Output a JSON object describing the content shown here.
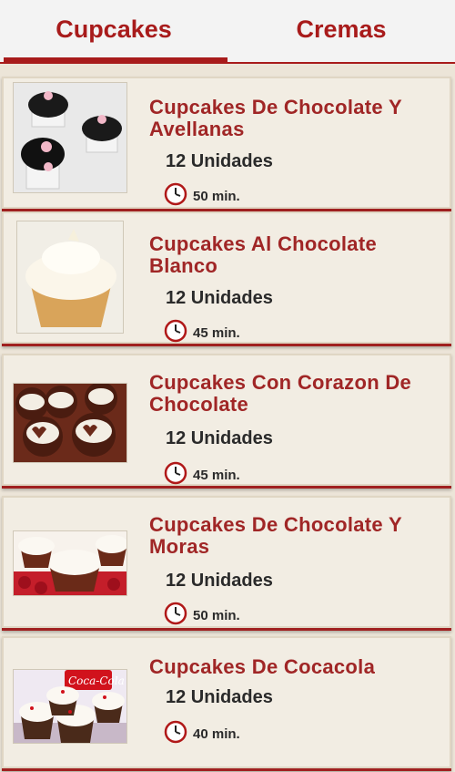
{
  "tabs": [
    {
      "label": "Cupcakes",
      "selected": true
    },
    {
      "label": "Cremas",
      "selected": false
    }
  ],
  "accent_color": "#a81b1b",
  "recipes": [
    {
      "title": "Cupcakes De Chocolate Y Avellanas",
      "units": "12 Unidades",
      "time": "50 min.",
      "image": "chocolate-cupcakes-flowers-photo"
    },
    {
      "title": "Cupcakes Al Chocolate Blanco",
      "units": "12 Unidades",
      "time": "45 min.",
      "image": "white-chocolate-cupcake-photo"
    },
    {
      "title": "Cupcakes Con Corazon De Chocolate",
      "units": "12 Unidades",
      "time": "45 min.",
      "image": "heart-cupcakes-photo"
    },
    {
      "title": "Cupcakes De Chocolate Y Moras",
      "units": "12 Unidades",
      "time": "50 min.",
      "image": "raspberry-cupcakes-photo"
    },
    {
      "title": "Cupcakes De Cocacola",
      "units": "12 Unidades",
      "time": "40 min.",
      "image": "cocacola-cupcakes-photo"
    }
  ]
}
